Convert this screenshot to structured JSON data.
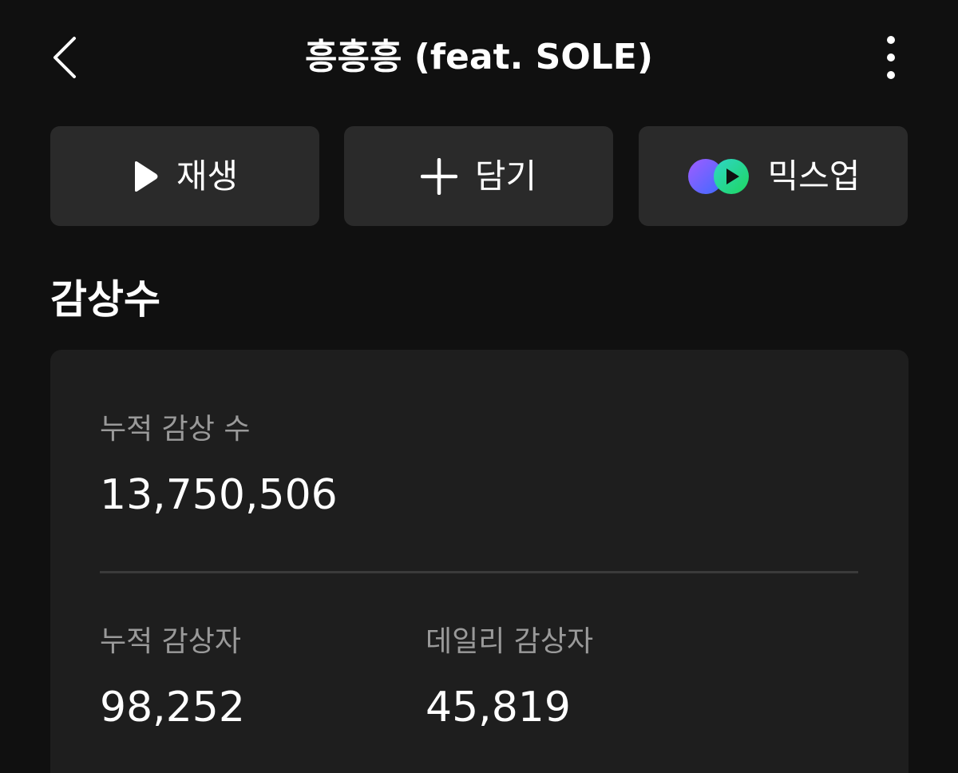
{
  "header": {
    "title": "흥흥흥 (feat. SOLE)",
    "back_icon": "chevron-left-icon",
    "more_icon": "more-vertical-icon"
  },
  "actions": {
    "play_label": "재생",
    "add_label": "담기",
    "mixup_label": "믹스업"
  },
  "section": {
    "title": "감상수"
  },
  "stats": {
    "total_plays_label": "누적 감상 수",
    "total_plays_value": "13,750,506",
    "total_listeners_label": "누적 감상자",
    "total_listeners_value": "98,252",
    "daily_listeners_label": "데일리 감상자",
    "daily_listeners_value": "45,819"
  },
  "colors": {
    "background": "#101010",
    "button_bg": "#2a2a2a",
    "card_bg": "#1e1e1e",
    "label_gray": "#9a9a9a",
    "mixup_purple": "#7b5cff",
    "mixup_green": "#1ed760"
  }
}
